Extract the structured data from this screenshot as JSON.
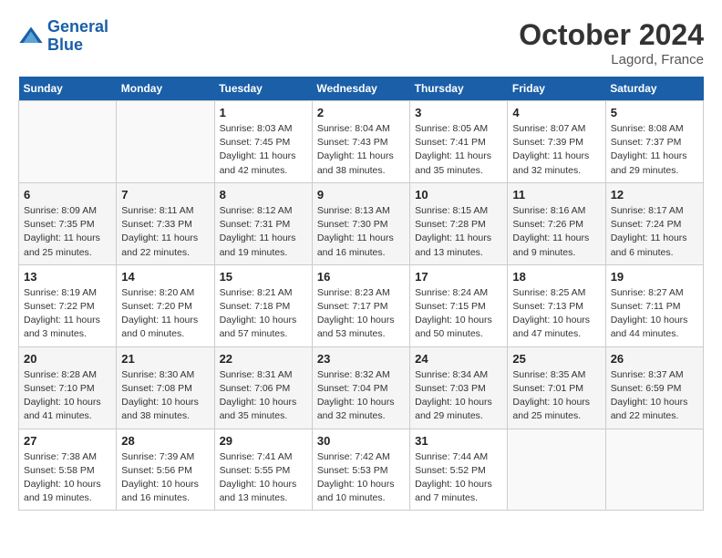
{
  "header": {
    "logo_general": "General",
    "logo_blue": "Blue",
    "month": "October 2024",
    "location": "Lagord, France"
  },
  "weekdays": [
    "Sunday",
    "Monday",
    "Tuesday",
    "Wednesday",
    "Thursday",
    "Friday",
    "Saturday"
  ],
  "weeks": [
    [
      {
        "day": "",
        "sunrise": "",
        "sunset": "",
        "daylight": ""
      },
      {
        "day": "",
        "sunrise": "",
        "sunset": "",
        "daylight": ""
      },
      {
        "day": "1",
        "sunrise": "Sunrise: 8:03 AM",
        "sunset": "Sunset: 7:45 PM",
        "daylight": "Daylight: 11 hours and 42 minutes."
      },
      {
        "day": "2",
        "sunrise": "Sunrise: 8:04 AM",
        "sunset": "Sunset: 7:43 PM",
        "daylight": "Daylight: 11 hours and 38 minutes."
      },
      {
        "day": "3",
        "sunrise": "Sunrise: 8:05 AM",
        "sunset": "Sunset: 7:41 PM",
        "daylight": "Daylight: 11 hours and 35 minutes."
      },
      {
        "day": "4",
        "sunrise": "Sunrise: 8:07 AM",
        "sunset": "Sunset: 7:39 PM",
        "daylight": "Daylight: 11 hours and 32 minutes."
      },
      {
        "day": "5",
        "sunrise": "Sunrise: 8:08 AM",
        "sunset": "Sunset: 7:37 PM",
        "daylight": "Daylight: 11 hours and 29 minutes."
      }
    ],
    [
      {
        "day": "6",
        "sunrise": "Sunrise: 8:09 AM",
        "sunset": "Sunset: 7:35 PM",
        "daylight": "Daylight: 11 hours and 25 minutes."
      },
      {
        "day": "7",
        "sunrise": "Sunrise: 8:11 AM",
        "sunset": "Sunset: 7:33 PM",
        "daylight": "Daylight: 11 hours and 22 minutes."
      },
      {
        "day": "8",
        "sunrise": "Sunrise: 8:12 AM",
        "sunset": "Sunset: 7:31 PM",
        "daylight": "Daylight: 11 hours and 19 minutes."
      },
      {
        "day": "9",
        "sunrise": "Sunrise: 8:13 AM",
        "sunset": "Sunset: 7:30 PM",
        "daylight": "Daylight: 11 hours and 16 minutes."
      },
      {
        "day": "10",
        "sunrise": "Sunrise: 8:15 AM",
        "sunset": "Sunset: 7:28 PM",
        "daylight": "Daylight: 11 hours and 13 minutes."
      },
      {
        "day": "11",
        "sunrise": "Sunrise: 8:16 AM",
        "sunset": "Sunset: 7:26 PM",
        "daylight": "Daylight: 11 hours and 9 minutes."
      },
      {
        "day": "12",
        "sunrise": "Sunrise: 8:17 AM",
        "sunset": "Sunset: 7:24 PM",
        "daylight": "Daylight: 11 hours and 6 minutes."
      }
    ],
    [
      {
        "day": "13",
        "sunrise": "Sunrise: 8:19 AM",
        "sunset": "Sunset: 7:22 PM",
        "daylight": "Daylight: 11 hours and 3 minutes."
      },
      {
        "day": "14",
        "sunrise": "Sunrise: 8:20 AM",
        "sunset": "Sunset: 7:20 PM",
        "daylight": "Daylight: 11 hours and 0 minutes."
      },
      {
        "day": "15",
        "sunrise": "Sunrise: 8:21 AM",
        "sunset": "Sunset: 7:18 PM",
        "daylight": "Daylight: 10 hours and 57 minutes."
      },
      {
        "day": "16",
        "sunrise": "Sunrise: 8:23 AM",
        "sunset": "Sunset: 7:17 PM",
        "daylight": "Daylight: 10 hours and 53 minutes."
      },
      {
        "day": "17",
        "sunrise": "Sunrise: 8:24 AM",
        "sunset": "Sunset: 7:15 PM",
        "daylight": "Daylight: 10 hours and 50 minutes."
      },
      {
        "day": "18",
        "sunrise": "Sunrise: 8:25 AM",
        "sunset": "Sunset: 7:13 PM",
        "daylight": "Daylight: 10 hours and 47 minutes."
      },
      {
        "day": "19",
        "sunrise": "Sunrise: 8:27 AM",
        "sunset": "Sunset: 7:11 PM",
        "daylight": "Daylight: 10 hours and 44 minutes."
      }
    ],
    [
      {
        "day": "20",
        "sunrise": "Sunrise: 8:28 AM",
        "sunset": "Sunset: 7:10 PM",
        "daylight": "Daylight: 10 hours and 41 minutes."
      },
      {
        "day": "21",
        "sunrise": "Sunrise: 8:30 AM",
        "sunset": "Sunset: 7:08 PM",
        "daylight": "Daylight: 10 hours and 38 minutes."
      },
      {
        "day": "22",
        "sunrise": "Sunrise: 8:31 AM",
        "sunset": "Sunset: 7:06 PM",
        "daylight": "Daylight: 10 hours and 35 minutes."
      },
      {
        "day": "23",
        "sunrise": "Sunrise: 8:32 AM",
        "sunset": "Sunset: 7:04 PM",
        "daylight": "Daylight: 10 hours and 32 minutes."
      },
      {
        "day": "24",
        "sunrise": "Sunrise: 8:34 AM",
        "sunset": "Sunset: 7:03 PM",
        "daylight": "Daylight: 10 hours and 29 minutes."
      },
      {
        "day": "25",
        "sunrise": "Sunrise: 8:35 AM",
        "sunset": "Sunset: 7:01 PM",
        "daylight": "Daylight: 10 hours and 25 minutes."
      },
      {
        "day": "26",
        "sunrise": "Sunrise: 8:37 AM",
        "sunset": "Sunset: 6:59 PM",
        "daylight": "Daylight: 10 hours and 22 minutes."
      }
    ],
    [
      {
        "day": "27",
        "sunrise": "Sunrise: 7:38 AM",
        "sunset": "Sunset: 5:58 PM",
        "daylight": "Daylight: 10 hours and 19 minutes."
      },
      {
        "day": "28",
        "sunrise": "Sunrise: 7:39 AM",
        "sunset": "Sunset: 5:56 PM",
        "daylight": "Daylight: 10 hours and 16 minutes."
      },
      {
        "day": "29",
        "sunrise": "Sunrise: 7:41 AM",
        "sunset": "Sunset: 5:55 PM",
        "daylight": "Daylight: 10 hours and 13 minutes."
      },
      {
        "day": "30",
        "sunrise": "Sunrise: 7:42 AM",
        "sunset": "Sunset: 5:53 PM",
        "daylight": "Daylight: 10 hours and 10 minutes."
      },
      {
        "day": "31",
        "sunrise": "Sunrise: 7:44 AM",
        "sunset": "Sunset: 5:52 PM",
        "daylight": "Daylight: 10 hours and 7 minutes."
      },
      {
        "day": "",
        "sunrise": "",
        "sunset": "",
        "daylight": ""
      },
      {
        "day": "",
        "sunrise": "",
        "sunset": "",
        "daylight": ""
      }
    ]
  ]
}
